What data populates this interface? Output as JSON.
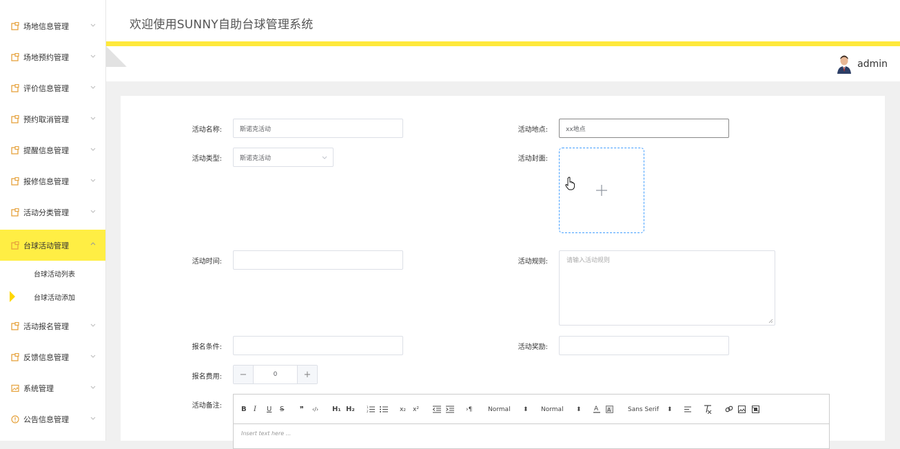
{
  "app": {
    "title": "欢迎使用SUNNY自助台球管理系统",
    "user": "admin"
  },
  "sidebar": {
    "items": [
      {
        "label": "场地信息管理"
      },
      {
        "label": "场地预约管理"
      },
      {
        "label": "评价信息管理"
      },
      {
        "label": "预约取消管理"
      },
      {
        "label": "提醒信息管理"
      },
      {
        "label": "报修信息管理"
      },
      {
        "label": "活动分类管理"
      },
      {
        "label": "台球活动管理"
      },
      {
        "label": "活动报名管理"
      },
      {
        "label": "反馈信息管理"
      },
      {
        "label": "系统管理"
      },
      {
        "label": "公告信息管理"
      }
    ],
    "sub_items": [
      {
        "label": "台球活动列表"
      },
      {
        "label": "台球活动添加"
      }
    ]
  },
  "form": {
    "name_label": "活动名称:",
    "name_value": "斯诺克活动",
    "location_label": "活动地点:",
    "location_value": "xx地点",
    "type_label": "活动类型:",
    "type_value": "斯诺克活动",
    "cover_label": "活动封面:",
    "time_label": "活动时间:",
    "rules_label": "活动规则:",
    "rules_placeholder": "请输入活动规则",
    "condition_label": "报名条件:",
    "reward_label": "活动奖励:",
    "fee_label": "报名费用:",
    "fee_value": "0",
    "notes_label": "活动备注:"
  },
  "editor": {
    "tb_bold": "B",
    "tb_italic": "I",
    "tb_underline": "U",
    "tb_strike": "S",
    "tb_quote": "❞",
    "tb_code": "‹/›",
    "tb_h1": "H₁",
    "tb_h2": "H₂",
    "tb_sub": "x₂",
    "tb_sup": "x²",
    "tb_dir": "›¶",
    "size_value": "Normal",
    "header_value": "Normal",
    "font_value": "Sans Serif",
    "placeholder": "Insert text here ..."
  },
  "colors": {
    "accent": "#ffee44",
    "top_line": "#ffe93b",
    "upload_border": "#409eff"
  }
}
